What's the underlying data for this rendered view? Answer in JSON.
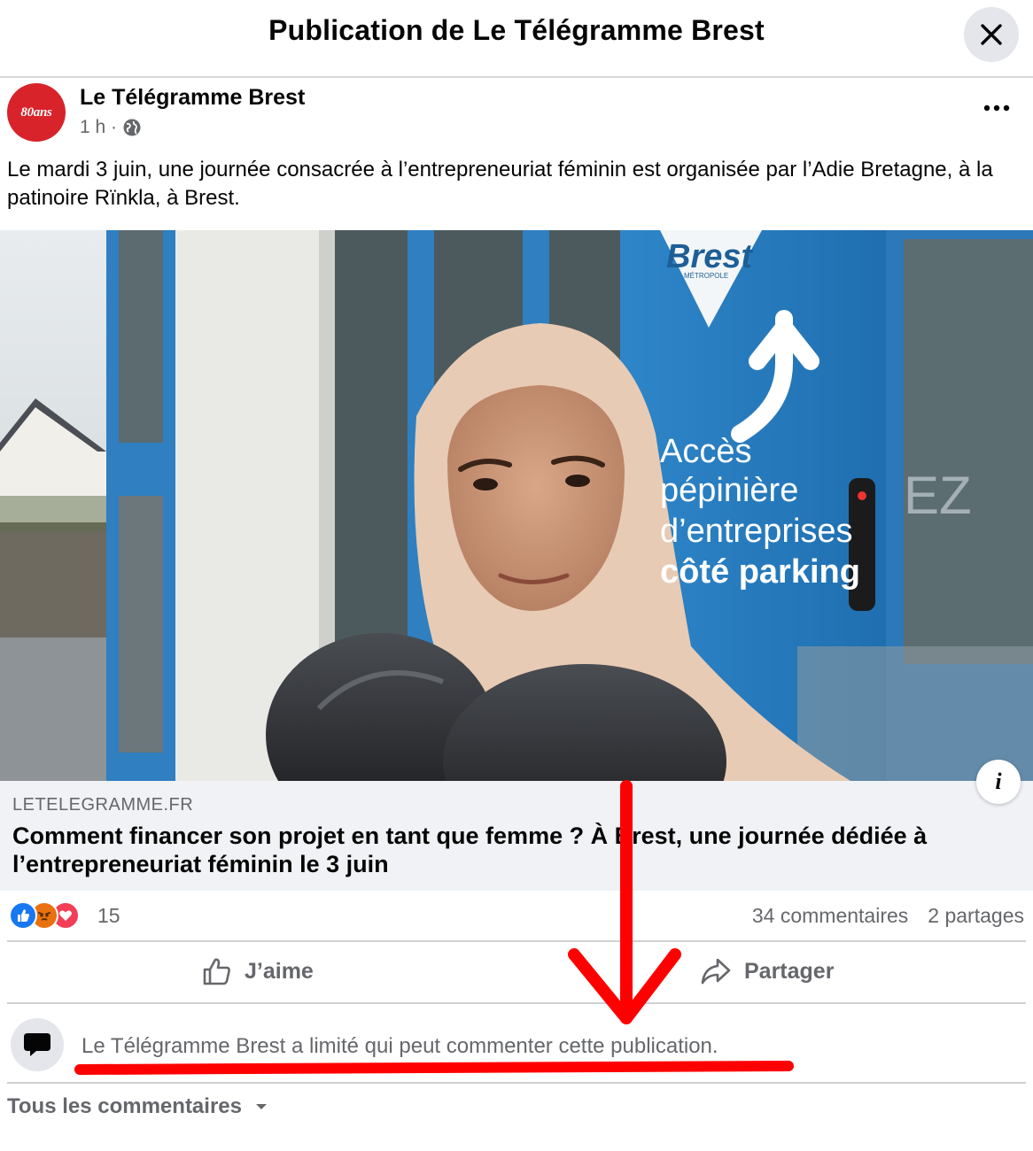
{
  "header": {
    "title": "Publication de Le Télégramme Brest",
    "close_icon": "close-icon"
  },
  "post": {
    "page_name": "Le Télégramme Brest",
    "avatar_text": "80ans",
    "time": "1 h ·",
    "audience_icon": "globe-icon",
    "more_icon": "more-dots-icon",
    "text": "Le mardi 3 juin, une journée consacrée à l’entrepreneuriat féminin est organisée par l’Adie Bretagne, à la patinoire Rïnkla, à Brest."
  },
  "link": {
    "image_sign_brand": "Brest",
    "image_sign_brand_sub": "MÉTROPOLE",
    "image_sign_lines": [
      "Accès",
      "pépinière",
      "d’entreprises",
      "côté parking"
    ],
    "image_door_text": "EZ",
    "info_label": "i",
    "domain": "LETELEGRAMME.FR",
    "title": "Comment financer son projet en tant que femme ? À Brest, une journée dédiée à l’entrepreneuriat féminin le 3 juin"
  },
  "stats": {
    "reaction_icons": [
      "like-reaction-icon",
      "angry-reaction-icon",
      "love-reaction-icon"
    ],
    "reactions_count": "15",
    "comments": "34 commentaires",
    "shares": "2 partages"
  },
  "actions": {
    "like_label": "J’aime",
    "share_label": "Partager"
  },
  "comments": {
    "limited_notice": "Le Télégramme Brest a limité qui peut commenter cette publication.",
    "filter_label": "Tous les commentaires"
  },
  "colors": {
    "text_primary": "#050505",
    "text_secondary": "#65676b",
    "caption_bg": "#f0f2f5",
    "brand_red": "#d8232a",
    "annotation_red": "#ff0000",
    "like_blue": "#1877f2",
    "love_red": "#f33e58",
    "angry_orange": "#e9710f"
  }
}
